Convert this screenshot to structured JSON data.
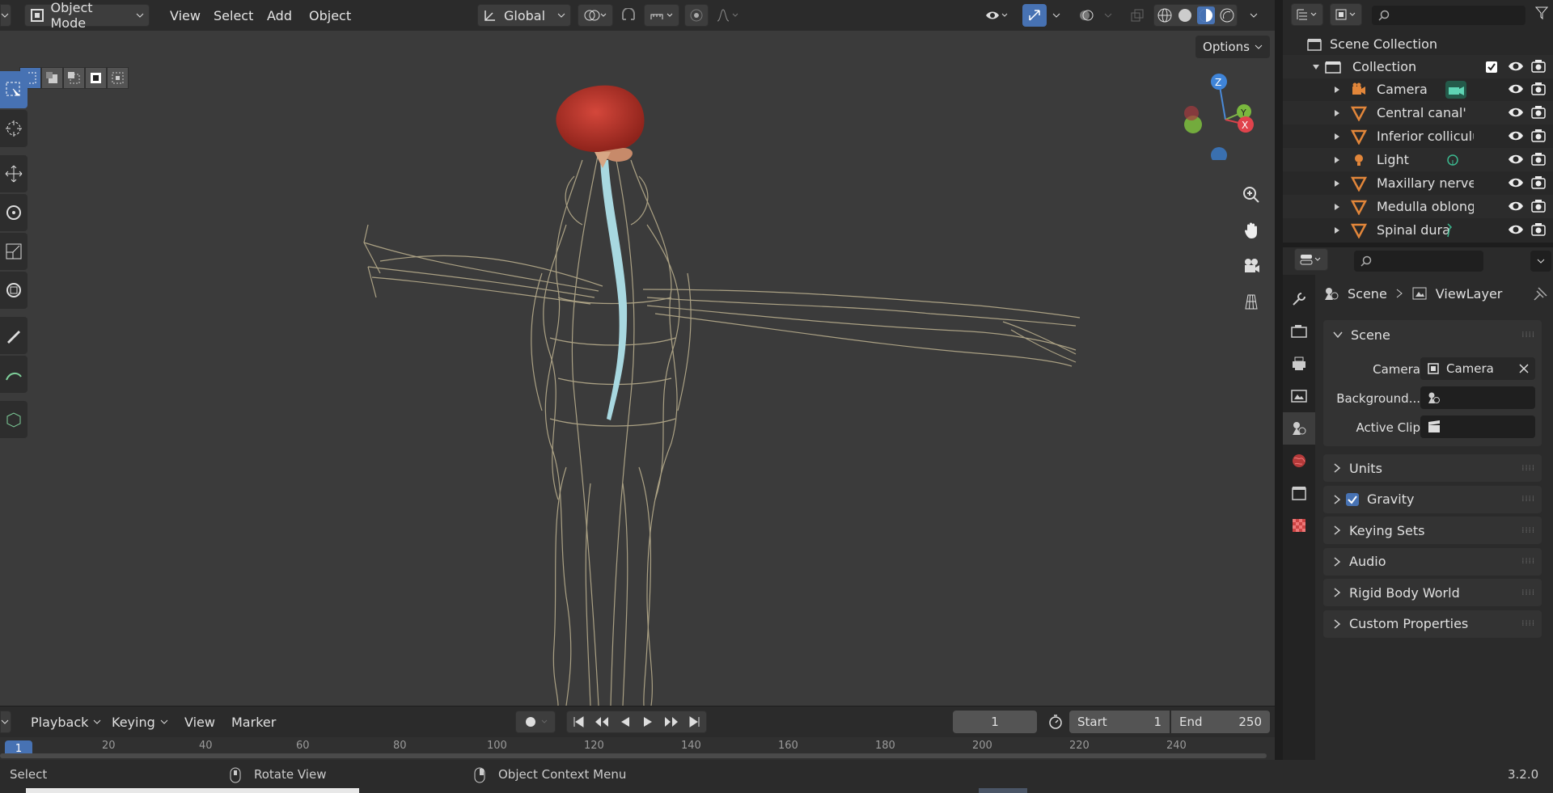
{
  "header": {
    "mode": "Object Mode",
    "menus": [
      "View",
      "Select",
      "Add",
      "Object"
    ],
    "orientation": "Global"
  },
  "viewport": {
    "options_label": "Options",
    "gizmo": {
      "z": "Z",
      "y": "Y",
      "x": "X"
    }
  },
  "outliner": {
    "root": "Scene Collection",
    "collection": "Collection",
    "items": [
      {
        "label": "Camera",
        "icon": "camera-object-icon"
      },
      {
        "label": "Central canal'",
        "icon": "mesh-icon"
      },
      {
        "label": "Inferior colliculus",
        "icon": "mesh-icon"
      },
      {
        "label": "Light",
        "icon": "light-object-icon"
      },
      {
        "label": "Maxillary nerve.l",
        "icon": "mesh-icon"
      },
      {
        "label": "Medulla oblongat",
        "icon": "mesh-icon"
      },
      {
        "label": "Spinal dura",
        "icon": "mesh-icon"
      }
    ]
  },
  "properties": {
    "breadcrumb_scene": "Scene",
    "breadcrumb_viewlayer": "ViewLayer",
    "scene_panel": {
      "title": "Scene",
      "camera_label": "Camera",
      "camera_value": "Camera",
      "background_label": "Background...",
      "active_clip_label": "Active Clip"
    },
    "panels": [
      {
        "label": "Units"
      },
      {
        "label": "Gravity"
      },
      {
        "label": "Keying Sets"
      },
      {
        "label": "Audio"
      },
      {
        "label": "Rigid Body World"
      },
      {
        "label": "Custom Properties"
      }
    ]
  },
  "timeline": {
    "menus": [
      "Playback",
      "Keying",
      "View",
      "Marker"
    ],
    "current_frame": "1",
    "start_label": "Start",
    "start_value": "1",
    "end_label": "End",
    "end_value": "250",
    "ruler_marks": [
      "1",
      "20",
      "40",
      "60",
      "80",
      "100",
      "120",
      "140",
      "160",
      "180",
      "200",
      "220",
      "240"
    ]
  },
  "statusbar": {
    "select": "Select",
    "rotate": "Rotate View",
    "context": "Object Context Menu",
    "version": "3.2.0"
  },
  "colors": {
    "accent": "#4772b3",
    "brain": "#c0362c",
    "spinal_cord": "#a8d8e0",
    "nerves": "#b8ad8c",
    "mesh_icon": "#e2863a"
  }
}
